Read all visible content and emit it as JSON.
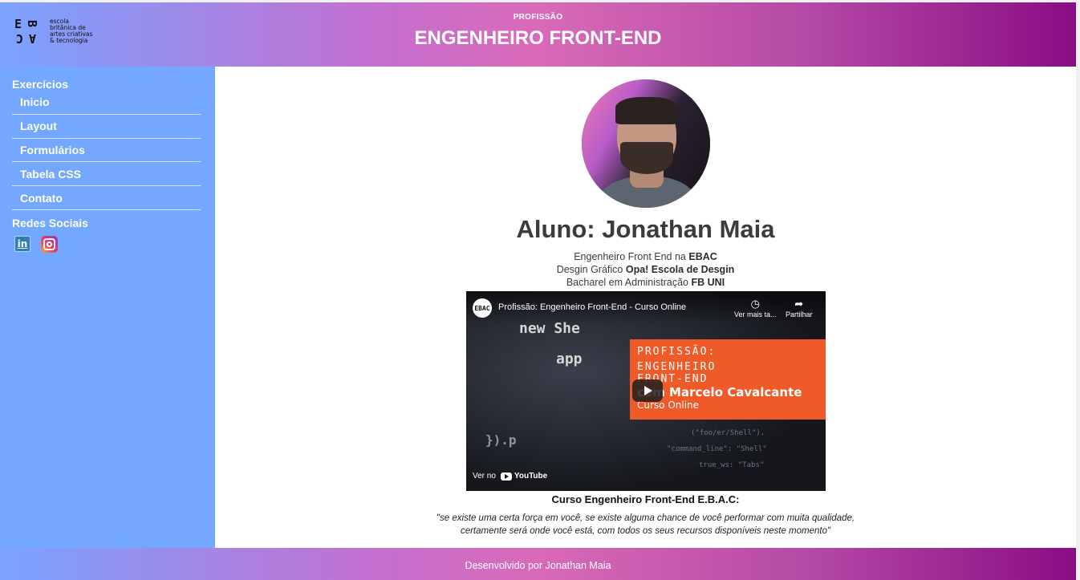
{
  "header": {
    "logo_mark": [
      "E",
      "B",
      "A",
      "C"
    ],
    "logo_lines": [
      "escola",
      "britânica de",
      "artes criativas",
      "& tecnologia"
    ],
    "subtitle": "PROFISSÃO",
    "title": "ENGENHEIRO FRONT-END"
  },
  "sidebar": {
    "heading": "Exercícios",
    "items": [
      {
        "label": "Inicio"
      },
      {
        "label": "Layout"
      },
      {
        "label": "Formulários"
      },
      {
        "label": "Tabela CSS"
      },
      {
        "label": "Contato"
      }
    ],
    "social_heading": "Redes Sociais",
    "social_icons": [
      "linkedin-icon",
      "instagram-icon"
    ],
    "linkedin_text": "in"
  },
  "main": {
    "student_name": "Aluno: Jonathan Maia",
    "bio": [
      {
        "text": "Engenheiro Front End na ",
        "bold": "EBAC"
      },
      {
        "text": "Desgin Gráfico ",
        "bold": "Opa! Escola de Desgin"
      },
      {
        "text": "Bacharel em Administração ",
        "bold": "FB UNI"
      }
    ],
    "video": {
      "channel_logo": "EBAC",
      "title": "Profissão: Engenheiro Front-End - Curso Online",
      "watch_later": "Ver mais ta...",
      "share": "Partilhar",
      "overlay_line1": "PROFISSÃO:",
      "overlay_line2": "ENGENHEIRO",
      "overlay_line3": "FRONT-END",
      "overlay_line4": "com Marcelo Cavalcante",
      "overlay_line5": "Curso Online",
      "watch_on": "Ver no",
      "youtube": "YouTube"
    },
    "course_title": "Curso Engenheiro Front-End E.B.A.C:",
    "quote_line1": "\"se existe uma certa força em você, se existe alguma chance de você performar com muita qualidade,",
    "quote_line2": "certamente será onde você está, com todos os seus recursos disponíveis neste momento\""
  },
  "footer": {
    "text": "Desenvolvido por Jonathan Maia"
  },
  "colors": {
    "sidebar_bg": "#74a7ff",
    "gradient_start": "#7aa3ff",
    "gradient_end": "#8a0d84",
    "video_overlay": "#f05a28"
  }
}
